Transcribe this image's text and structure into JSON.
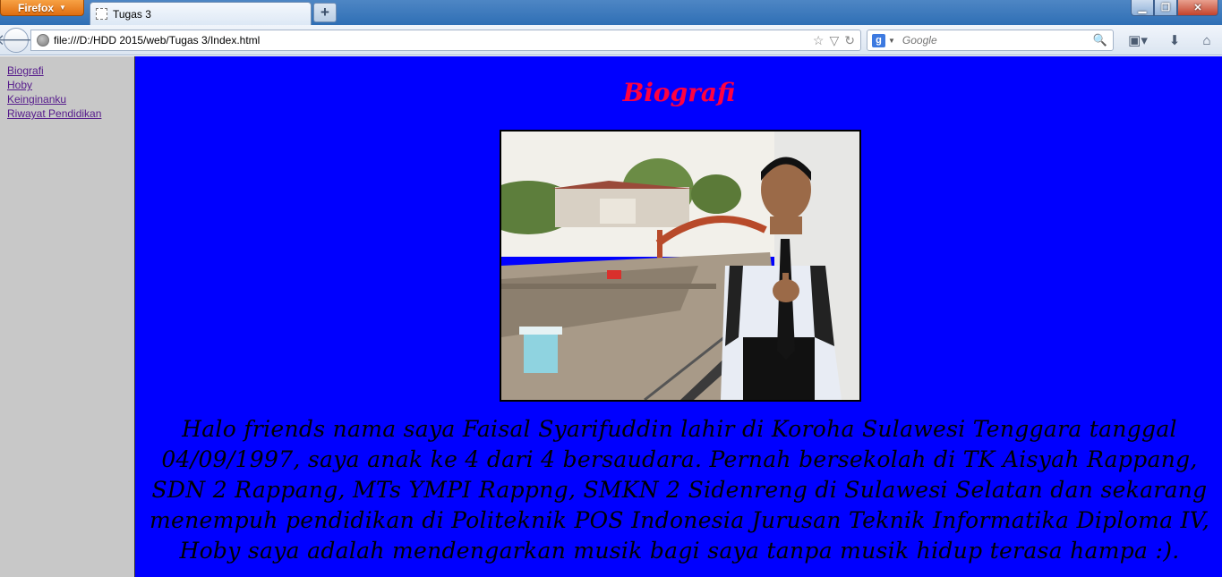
{
  "browser": {
    "app_button": "Firefox",
    "tab_title": "Tugas 3",
    "new_tab": "+",
    "url": "file:///D:/HDD 2015/web/Tugas 3/Index.html",
    "search_placeholder": "Google",
    "window_controls": [
      "minimize-icon",
      "restore-icon",
      "close-icon"
    ]
  },
  "sidebar": {
    "links": [
      "Biografi",
      "Hoby",
      "Keinginanku",
      "Riwayat Pendidikan"
    ]
  },
  "main": {
    "title": "Biografi",
    "bio": "Halo friends nama saya Faisal Syarifuddin lahir di Koroha Sulawesi Tenggara tanggal 04/09/1997, saya anak ke 4 dari 4 bersaudara. Pernah bersekolah di TK Aisyah Rappang, SDN 2 Rappang, MTs YMPI Rappng, SMKN 2 Sidenreng di Sulawesi Selatan dan sekarang menempuh pendidikan di Politeknik POS Indonesia Jurusan Teknik Informatika Diploma IV, Hoby saya adalah mendengarkan musik bagi saya tanpa musik hidup terasa hampa :)."
  },
  "colors": {
    "main_bg": "#0000ff",
    "sidebar_bg": "#c8c8c8",
    "title_color": "#ff0040",
    "link_color": "#551a8b"
  }
}
